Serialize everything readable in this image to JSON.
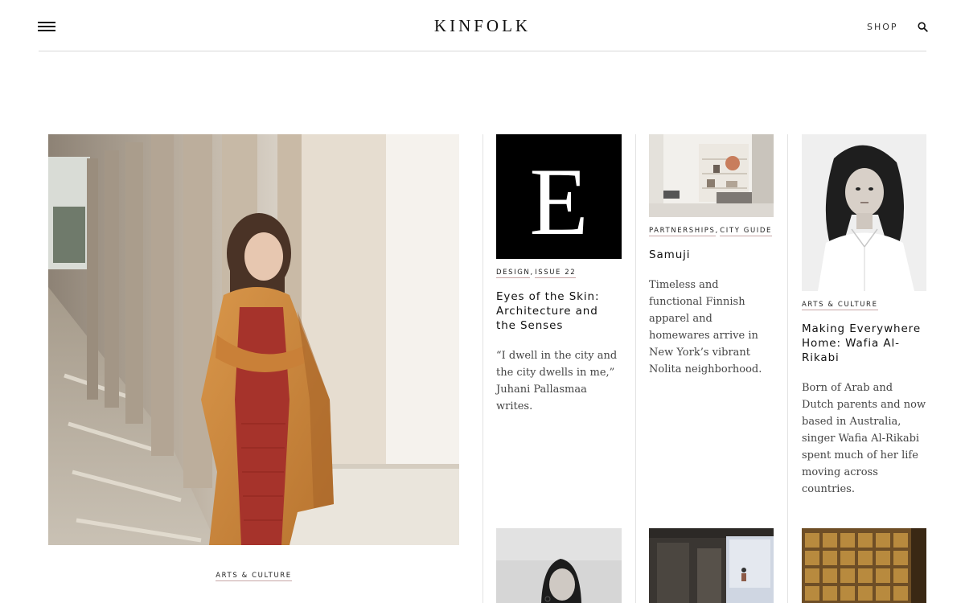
{
  "header": {
    "logo": "KINFOLK",
    "shop_label": "SHOP"
  },
  "hero": {
    "tag": "ARTS & CULTURE"
  },
  "articles": [
    {
      "tags": [
        "DESIGN",
        "ISSUE 22"
      ],
      "title": "Eyes of the Skin: Architecture and the Senses",
      "excerpt": "“I dwell in the city and the city dwells in me,” Juhani Pallasmaa writes.",
      "thumb_letter": "E"
    },
    {
      "tags": [
        "PARTNERSHIPS",
        "CITY GUIDE"
      ],
      "title": "Samuji",
      "excerpt": "Timeless and functional Finnish apparel and homewares arrive in New York’s vibrant Nolita neighborhood."
    },
    {
      "tags": [
        "ARTS & CULTURE"
      ],
      "title": "Making Everywhere Home: Wafia Al-Rikabi",
      "excerpt": "Born of Arab and Dutch parents and now based in Australia, singer Wafia Al-Rikabi spent much of her life moving across countries."
    }
  ],
  "icons": {
    "menu": "hamburger-icon",
    "search": "search-icon"
  },
  "colors": {
    "tag_underline": "#c7a5a5",
    "text": "#111111",
    "excerpt": "#444444",
    "rule": "#d8d8d8"
  }
}
